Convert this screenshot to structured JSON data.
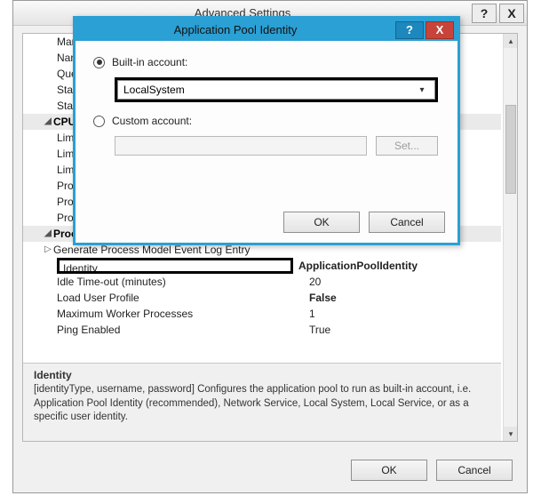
{
  "adv": {
    "title": "Advanced Settings",
    "help_icon": "?",
    "close_icon": "X",
    "rows_top": [
      {
        "name": "Mar"
      },
      {
        "name": "Nam"
      },
      {
        "name": "Que"
      },
      {
        "name": "Star"
      },
      {
        "name": "Star"
      }
    ],
    "cat_cpu": "CPU",
    "rows_cpu": [
      {
        "name": "Lim"
      },
      {
        "name": "Lim"
      },
      {
        "name": "Lim"
      },
      {
        "name": "Pro"
      },
      {
        "name": "Pro"
      },
      {
        "name": "Pro"
      }
    ],
    "cat_pm": "Process Model",
    "rows_pm": [
      {
        "name": "Generate Process Model Event Log Entry",
        "val": "",
        "expander": true
      },
      {
        "name": "Identity",
        "val": "ApplicationPoolIdentity",
        "highlight": true
      },
      {
        "name": "Idle Time-out (minutes)",
        "val": "20"
      },
      {
        "name": "Load User Profile",
        "val": "False",
        "bold": true
      },
      {
        "name": "Maximum Worker Processes",
        "val": "1"
      },
      {
        "name": "Ping Enabled",
        "val": "True"
      }
    ],
    "help": {
      "title": "Identity",
      "body": "[identityType, username, password] Configures the application pool to run as built-in account, i.e. Application Pool Identity (recommended), Network Service, Local System, Local Service, or as a specific user identity."
    },
    "ok": "OK",
    "cancel": "Cancel"
  },
  "api": {
    "title": "Application Pool Identity",
    "help_icon": "?",
    "close_icon": "X",
    "builtin_label": "Built-in account:",
    "builtin_value": "LocalSystem",
    "custom_label": "Custom account:",
    "set_label": "Set...",
    "ok": "OK",
    "cancel": "Cancel"
  }
}
